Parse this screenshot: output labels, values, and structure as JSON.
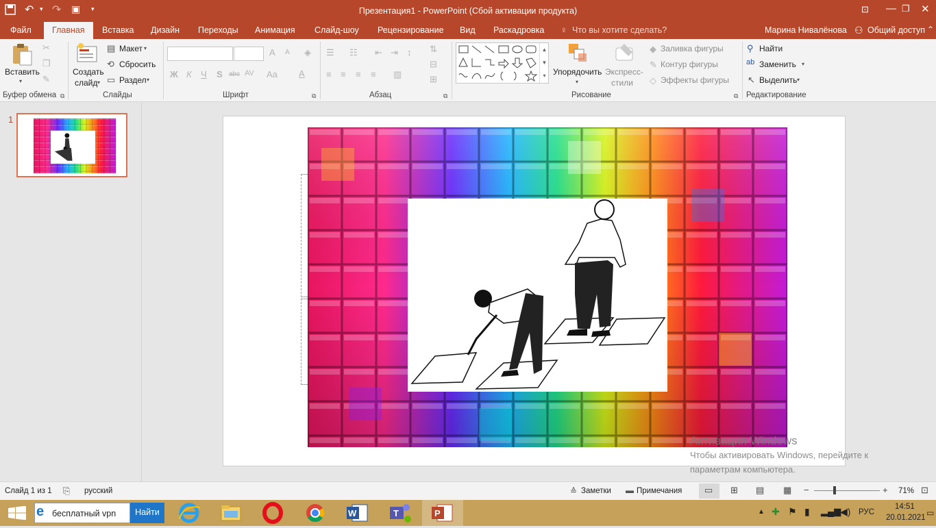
{
  "window": {
    "title": "Презентация1 - PowerPoint (Сбой активации продукта)"
  },
  "ribbon_tabs": [
    "Файл",
    "Главная",
    "Вставка",
    "Дизайн",
    "Переходы",
    "Анимация",
    "Слайд-шоу",
    "Рецензирование",
    "Вид",
    "Раскадровка"
  ],
  "tell_me": "Что вы хотите сделать?",
  "user_name": "Марина Нивалёнова",
  "share": "Общий доступ",
  "clipboard": {
    "paste": "Вставить",
    "group": "Буфер обмена"
  },
  "slides_group": {
    "new_slide_line1": "Создать",
    "new_slide_line2": "слайд",
    "layout": "Макет",
    "reset": "Сбросить",
    "section": "Раздел",
    "group": "Слайды"
  },
  "font_group": {
    "group": "Шрифт",
    "bold": "Ж",
    "italic": "К",
    "underline": "Ч",
    "shadow": "S",
    "strike": "abc",
    "spacing": "AV",
    "case": "Aa",
    "color": "A",
    "grow": "A",
    "shrink": "A"
  },
  "paragraph_group": {
    "group": "Абзац"
  },
  "drawing": {
    "arrange": "Упорядочить",
    "quick_styles_line1": "Экспресс-",
    "quick_styles_line2": "стили",
    "fill": "Заливка фигуры",
    "outline": "Контур фигуры",
    "effects": "Эффекты фигуры",
    "group": "Рисование"
  },
  "editing": {
    "find": "Найти",
    "replace": "Заменить",
    "select": "Выделить",
    "group": "Редактирование"
  },
  "thumbnail": {
    "number": "1"
  },
  "watermark": {
    "title": "Активация Windows",
    "line1": "Чтобы активировать Windows, перейдите к",
    "line2": "параметрам компьютера."
  },
  "status": {
    "slide": "Слайд 1 из 1",
    "language": "русский",
    "notes": "Заметки",
    "comments": "Примечания",
    "zoom": "71%"
  },
  "taskbar": {
    "search_value": "бесплатный vpn",
    "search_button": "Найти",
    "lang": "РУС",
    "time": "14:51",
    "date": "20.01.2021"
  },
  "colors": {
    "accent": "#b7472a",
    "taskbar": "#c5a15a"
  }
}
